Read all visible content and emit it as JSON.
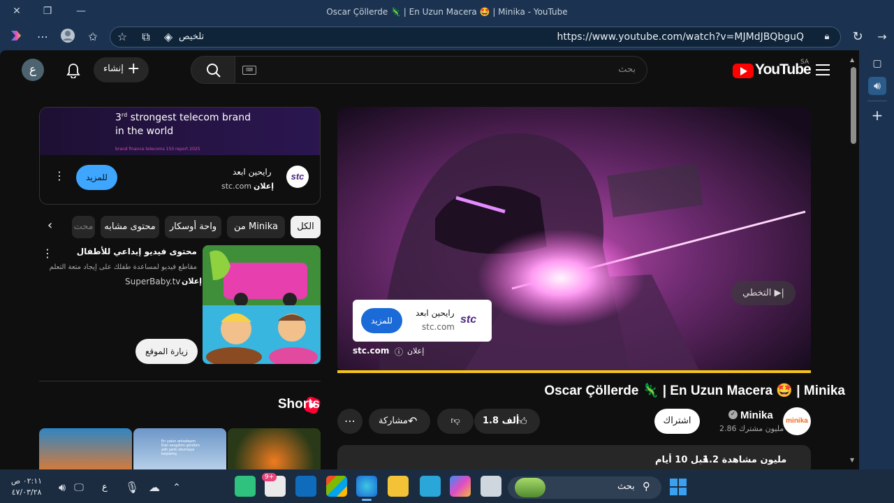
{
  "window": {
    "title": "Oscar Çöllerde 🦎 | En Uzun Macera 🤩 | Minika - YouTube"
  },
  "browser": {
    "url": "https://www.youtube.com/watch?v=MJMdJBQbguQ",
    "summarize_label": "تلخيص"
  },
  "header": {
    "logo_text": "YouTube",
    "region": "SA",
    "search_placeholder": "بحث",
    "create_label": "إنشاء",
    "avatar_letter": "ع"
  },
  "video": {
    "skip_label": "التخطي",
    "ad_card": {
      "name": "رايحين ابعد",
      "domain": "stc.com",
      "button": "للمزيد"
    },
    "ad_footer": {
      "domain": "stc.com",
      "ad_label": "إعلان"
    },
    "title": "Oscar Çöllerde 🦎 | En Uzun Macera 🤩 | Minika",
    "channel": {
      "name": "Minika",
      "subs": "2.86 مليون مشترك",
      "logo": "minika"
    },
    "subscribe_label": "اشتراك",
    "likes": "1.8 ألف",
    "share_label": "مشاركة",
    "description": {
      "views": "1.2 مليون مشاهدة",
      "age": "قبل 10 أيام"
    }
  },
  "sidebar": {
    "top_ad": {
      "headline_sup": "rd",
      "headline_pre": "3",
      "headline_1": "strongest telecom brand",
      "headline_2": "in the world",
      "fineprint": "brand finance telecoms 150 report 2025",
      "advertiser": "رايحين ابعد",
      "domain": "stc.com",
      "ad_label": "إعلان",
      "button": "للمزيد"
    },
    "chips": [
      "الكل",
      "من Minika",
      "واحة أوسكار",
      "محتوى مشابه",
      "محت"
    ],
    "promo": {
      "title": "محتوى فيديو إبداعي للأطفال",
      "desc": "مقاطع فيديو لمساعدة طفلك على إيجاد متعة التعلم",
      "ad_label": "إعلان",
      "domain": "SuperBaby.tv",
      "visit_label": "زيارة الموقع"
    },
    "shorts_title": "Shorts",
    "short_caption": "En yakın arkadaşım Eski sevgilimi gördüm adlı şarkı okumaya başlamış"
  },
  "taskbar": {
    "search_placeholder": "بحث",
    "time": "٠٢:١١ ص",
    "date": "٤٧/٠٣/٢٨",
    "lang": "ع",
    "badge": "9+"
  },
  "colors": {
    "yt_red": "#ff0000",
    "accent_blue": "#1a6ad8",
    "progress": "#f5c518",
    "stc": "#4f2683"
  }
}
